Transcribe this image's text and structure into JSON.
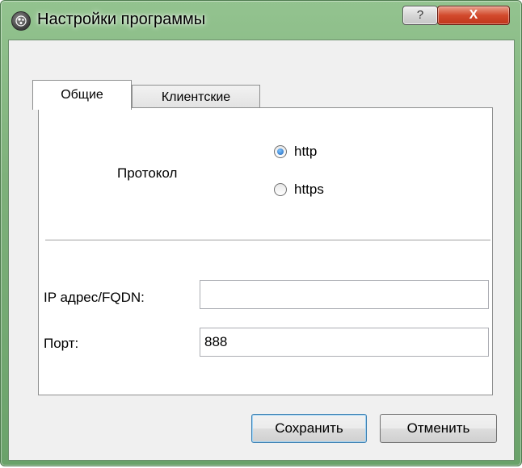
{
  "window": {
    "title": "Настройки программы",
    "icon": "app-globe-icon",
    "help_label": "?",
    "close_label": "X"
  },
  "tabs": [
    {
      "label": "Общие",
      "active": true
    },
    {
      "label": "Клиентские",
      "active": false
    }
  ],
  "protocol": {
    "label": "Протокол",
    "options": [
      {
        "label": "http",
        "checked": true
      },
      {
        "label": "https",
        "checked": false
      }
    ]
  },
  "fields": {
    "ip_label": "IP адрес/FQDN:",
    "ip_value": "",
    "port_label": "Порт:",
    "port_value": "888"
  },
  "buttons": {
    "save_label": "Сохранить",
    "cancel_label": "Отменить"
  },
  "colors": {
    "frame": "#7db07a",
    "close_button": "#d24a2d",
    "radio_checked": "#1d62b8"
  }
}
